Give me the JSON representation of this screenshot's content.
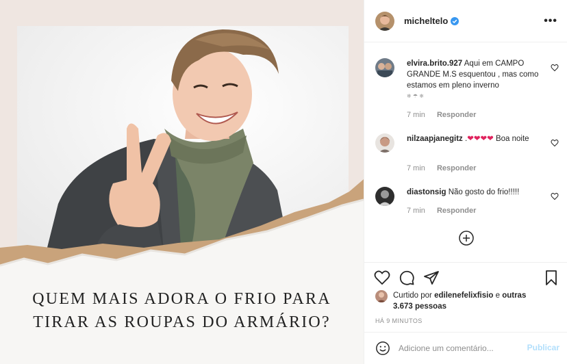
{
  "post": {
    "caption_lines": [
      "QUEM MAIS ADORA O FRIO PARA",
      "TIRAR AS ROUPAS DO ARMÁRIO?"
    ]
  },
  "header": {
    "username": "micheltelo",
    "more_label": "•••",
    "icons": [
      "verified-badge-icon",
      "more-options-icon"
    ]
  },
  "comments": [
    {
      "user": "elvira.brito.927",
      "text": "Aqui em CAMPO GRANDE M.S esquentou , mas como estamos em pleno inverno",
      "extra": "❄ ☂ ❄",
      "time": "7 min",
      "reply": "Responder"
    },
    {
      "user": "nilzaapjanegitz",
      "text_prefix": ".",
      "hearts": "❤❤❤❤",
      "text": "Boa noite",
      "time": "7 min",
      "reply": "Responder"
    },
    {
      "user": "diastonsig",
      "text": "Não gosto do frio!!!!!",
      "time": "7 min",
      "reply": "Responder"
    }
  ],
  "likes": {
    "prefix": "Curtido por",
    "user": "edilenefelixfisio",
    "connector": "e",
    "others": "outras 3.673 pessoas"
  },
  "timestamp": "HÁ 9 MINUTOS",
  "add_comment": {
    "placeholder": "Adicione um comentário...",
    "post_label": "Publicar"
  },
  "colors": {
    "verified": "#3897f0",
    "link_disabled": "#b2dffc",
    "muted": "#8e8e8e",
    "heart": "#e0245e"
  }
}
